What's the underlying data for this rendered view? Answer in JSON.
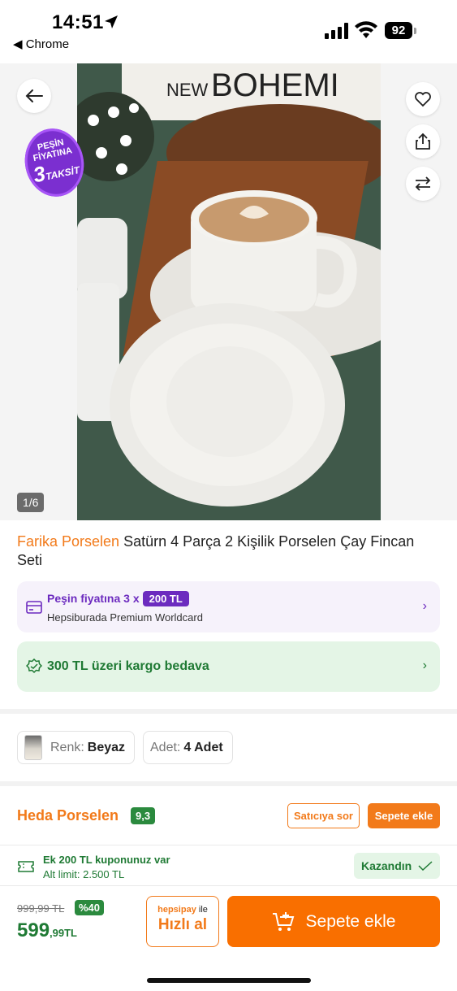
{
  "status_bar": {
    "time": "14:51",
    "back_app": "◀ Chrome",
    "battery": "92"
  },
  "gallery": {
    "promo_badge": {
      "line1": "PEŞİN",
      "line2": "FİYATINA",
      "number": "3",
      "suffix": "TAKSİT"
    },
    "photo_text": "THE NEW BOHEMI",
    "page_counter": "1/6",
    "icons": [
      "back-arrow-icon",
      "heart-icon",
      "share-icon",
      "compare-icon"
    ]
  },
  "product": {
    "brand": "Farika Porselen",
    "name": " Satürn 4 Parça 2 Kişilik Porselen Çay Fincan Seti"
  },
  "installment": {
    "prefix": "Peşin fiyatına 3 x",
    "amount": "200 TL",
    "card": "Hepsiburada Premium Worldcard"
  },
  "cargo": {
    "text": "300 TL üzeri kargo bedava"
  },
  "variants": {
    "color_key": "Renk:",
    "color_value": "Beyaz",
    "qty_key": "Adet:",
    "qty_value": "4 Adet"
  },
  "seller": {
    "name": "Heda Porselen",
    "score": "9,3",
    "ask_label": "Satıcıya sor",
    "add_label": "Sepete ekle"
  },
  "coupon": {
    "line1": "Ek 200 TL kuponunuz var",
    "line2": "Alt limit: 2.500 TL",
    "won_label": "Kazandın"
  },
  "bottom_bar": {
    "old_price": "999,99 TL",
    "discount": "%40",
    "price_main": "599",
    "price_fraction": ",99TL",
    "hepsipay_brand": "hepsipay",
    "hepsipay_suffix": " ile",
    "quick_buy": "Hızlı al",
    "add_to_cart": "Sepete ekle"
  },
  "colors": {
    "accent_orange": "#f27a1a",
    "installment_purple": "#6c2bbf",
    "success_green": "#1f7a34"
  }
}
